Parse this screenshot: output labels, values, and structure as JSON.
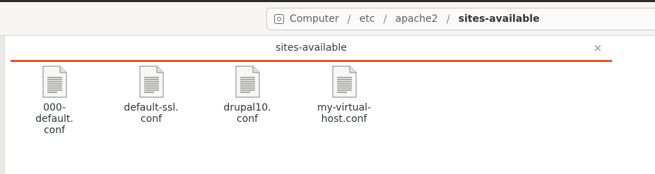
{
  "breadcrumb": {
    "root_icon": "disk-icon",
    "items": [
      "Computer",
      "etc",
      "apache2",
      "sites-available"
    ],
    "separator": "/"
  },
  "tab": {
    "label": "sites-available",
    "close_glyph": "×",
    "accent": "#e95420"
  },
  "files": [
    {
      "icon": "text-file-icon",
      "name": "000-default.conf",
      "line1": "000-",
      "line2": "default.",
      "line3": "conf"
    },
    {
      "icon": "text-file-icon",
      "name": "default-ssl.conf",
      "line1": "default-ssl.",
      "line2": "conf",
      "line3": ""
    },
    {
      "icon": "text-file-icon",
      "name": "drupal10.conf",
      "line1": "drupal10.",
      "line2": "conf",
      "line3": ""
    },
    {
      "icon": "text-file-icon",
      "name": "my-virtual-host.conf",
      "line1": "my-virtual-",
      "line2": "host.conf",
      "line3": ""
    }
  ]
}
